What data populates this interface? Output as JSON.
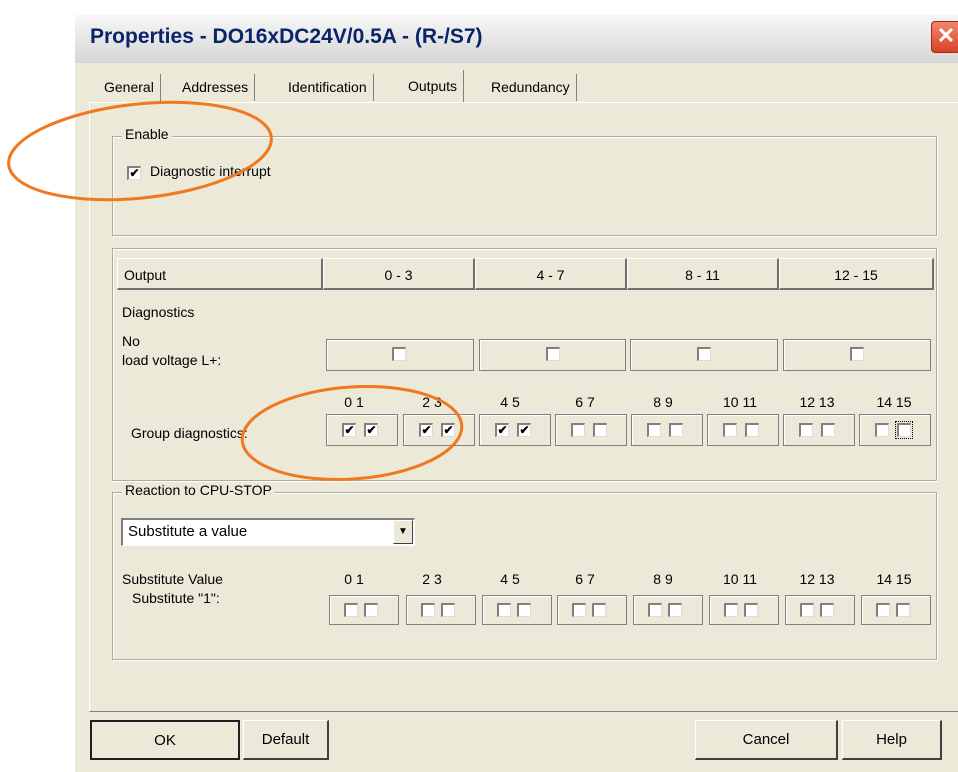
{
  "window": {
    "title": "Properties - DO16xDC24V/0.5A - (R-/S7)",
    "close_glyph": "✕"
  },
  "tabs": [
    "General",
    "Addresses",
    "Identification",
    "Outputs",
    "Redundancy"
  ],
  "active_tab": "Outputs",
  "enable": {
    "group_label": "Enable",
    "diag_interrupt_label": "Diagnostic interrupt",
    "diag_interrupt_checked": true
  },
  "output_table": {
    "header_label": "Output",
    "columns": [
      "0 - 3",
      "4 - 7",
      "8 - 11",
      "12 - 15"
    ],
    "diagnostics_label": "Diagnostics",
    "no_load_line1": "No",
    "no_load_line2": "load voltage L+:",
    "no_load_checked": [
      false,
      false,
      false,
      false
    ],
    "group_diag_label": "Group diagnostics:",
    "bit_pairs": [
      "0  1",
      "2  3",
      "4  5",
      "6  7",
      "8  9",
      "10 11",
      "12 13",
      "14 15"
    ],
    "group_diag_checked": [
      true,
      true,
      true,
      true,
      true,
      true,
      false,
      false,
      false,
      false,
      false,
      false,
      false,
      false,
      false,
      false
    ]
  },
  "reaction": {
    "group_label": "Reaction to CPU-STOP",
    "select_value": "Substitute a value",
    "substitute_value_label": "Substitute Value",
    "substitute_one_label": "Substitute \"1\":",
    "bit_pairs": [
      "0  1",
      "2  3",
      "4  5",
      "6  7",
      "8  9",
      "10 11",
      "12 13",
      "14 15"
    ],
    "substitute_checked": [
      false,
      false,
      false,
      false,
      false,
      false,
      false,
      false,
      false,
      false,
      false,
      false,
      false,
      false,
      false,
      false
    ]
  },
  "buttons": {
    "ok": "OK",
    "default": "Default",
    "cancel": "Cancel",
    "help": "Help"
  },
  "colors": {
    "annotation": "#f07820",
    "title_text": "#0a246a",
    "dialog_bg": "#ece9d8"
  }
}
